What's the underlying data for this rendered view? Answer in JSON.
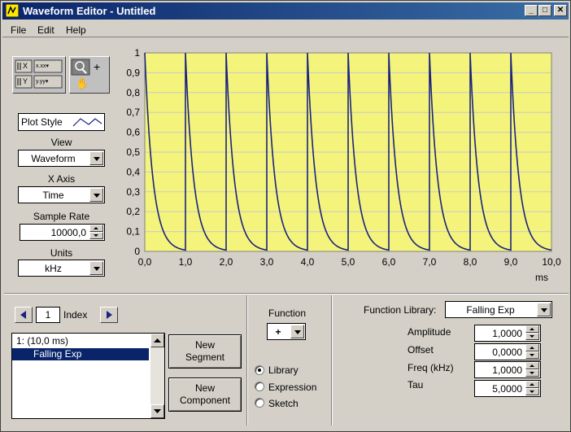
{
  "window": {
    "title": "Waveform Editor - Untitled",
    "buttons": {
      "minimize": "_",
      "maximize": "□",
      "close": "✕"
    }
  },
  "menu": {
    "items": [
      "File",
      "Edit",
      "Help"
    ]
  },
  "left_panel": {
    "plot_style_label": "Plot Style",
    "view": {
      "label": "View",
      "value": "Waveform"
    },
    "x_axis": {
      "label": "X Axis",
      "value": "Time"
    },
    "sample_rate": {
      "label": "Sample Rate",
      "value": "10000,0"
    },
    "units": {
      "label": "Units",
      "value": "kHz"
    }
  },
  "chart_data": {
    "type": "line",
    "title": "",
    "xlabel": "ms",
    "ylabel": "",
    "xlim": [
      0,
      10
    ],
    "ylim": [
      0,
      1
    ],
    "x_ticks": [
      "0,0",
      "1,0",
      "2,0",
      "3,0",
      "4,0",
      "5,0",
      "6,0",
      "7,0",
      "8,0",
      "9,0",
      "10,0"
    ],
    "y_ticks": [
      "0",
      "0,1",
      "0,2",
      "0,3",
      "0,4",
      "0,5",
      "0,6",
      "0,7",
      "0,8",
      "0,9",
      "1"
    ],
    "grid": true,
    "plot_background": "#f4f47c",
    "series": [
      {
        "function": "falling exponential, period 1 ms, amplitude 1, offset 0, tau 5",
        "period_ms": 1,
        "amplitude": 1,
        "offset": 0,
        "tau": 5,
        "color": "#1a237e"
      }
    ]
  },
  "segments": {
    "index_value": "1",
    "index_label": "Index",
    "list": [
      {
        "text": "1:  (10,0 ms)",
        "selected": false
      },
      {
        "text": "Falling Exp",
        "selected": true
      }
    ],
    "new_segment_line1": "New",
    "new_segment_line2": "Segment",
    "new_component_line1": "New",
    "new_component_line2": "Component"
  },
  "function_panel": {
    "label": "Function",
    "operator": "+",
    "options": [
      "Library",
      "Expression",
      "Sketch"
    ],
    "selected": "Library"
  },
  "library_panel": {
    "label": "Function Library:",
    "value": "Falling Exp",
    "params": [
      {
        "name": "Amplitude",
        "value": "1,0000"
      },
      {
        "name": "Offset",
        "value": "0,0000"
      },
      {
        "name": "Freq (kHz)",
        "value": "1,0000"
      },
      {
        "name": "Tau",
        "value": "5,0000"
      }
    ]
  },
  "colors": {
    "titlebar_start": "#0a246a",
    "titlebar_end": "#3a6ea5",
    "plot_background": "#f4f47c",
    "trace": "#1a237e",
    "selection": "#0a246a"
  }
}
